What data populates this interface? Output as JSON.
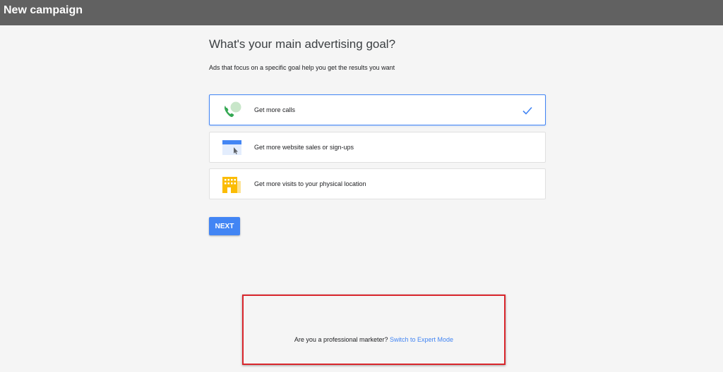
{
  "header": {
    "title": "New campaign"
  },
  "main": {
    "heading": "What's your main advertising goal?",
    "subheading": "Ads that focus on a specific goal help you get the results you want",
    "options": [
      {
        "label": "Get more calls",
        "icon": "phone-icon",
        "selected": true
      },
      {
        "label": "Get more website sales or sign-ups",
        "icon": "website-icon",
        "selected": false
      },
      {
        "label": "Get more visits to your physical location",
        "icon": "building-icon",
        "selected": false
      }
    ],
    "next_label": "NEXT"
  },
  "footer": {
    "question": "Are you a professional marketer?",
    "link_label": "Switch to Expert Mode"
  },
  "colors": {
    "accent": "#4285f4",
    "header_bg": "#616161",
    "highlight_box": "#d9262c"
  }
}
